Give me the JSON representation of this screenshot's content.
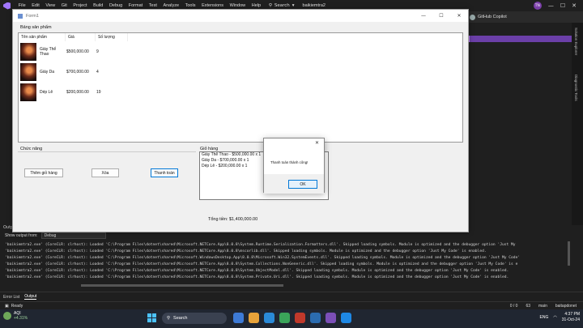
{
  "vs": {
    "menu": [
      "File",
      "Edit",
      "View",
      "Git",
      "Project",
      "Build",
      "Debug",
      "Format",
      "Test",
      "Analyze",
      "Tools",
      "Extensions",
      "Window",
      "Help"
    ],
    "search_label": "Search",
    "project_name": "baikiemtra2",
    "avatar_initials": "TN",
    "copilot_label": "GitHub Copilot",
    "side_tabs": [
      "Solution Explorer",
      "Diagnostic Tools"
    ]
  },
  "form": {
    "title": "Form1",
    "products_group": "Bảng sản phẩm",
    "columns": [
      "Tên sản phẩm",
      "Giá",
      "Số lượng"
    ],
    "rows": [
      {
        "name": "Giày Thể Thao",
        "price": "$500,000.00",
        "qty": "9"
      },
      {
        "name": "Giày Da",
        "price": "$700,000.00",
        "qty": "4"
      },
      {
        "name": "Dép Lê",
        "price": "$200,000.00",
        "qty": "19"
      }
    ],
    "functions_group": "Chức năng",
    "btn_add": "Thêm giỏ hàng",
    "btn_delete": "Xóa",
    "btn_checkout": "Thanh toán",
    "cart_group": "Giỏ hàng",
    "cart_items": [
      "Giày Thể Thao - $500,000.00 x 1",
      "Giày Da - $700,000.00 x 1",
      "Dép Lê - $200,000.00 x 1"
    ],
    "total": "Tổng tiền: $1,400,000.00"
  },
  "dialog": {
    "message": "Thanh toán thành công!",
    "ok": "OK"
  },
  "output": {
    "title": "Output",
    "show_from_label": "Show output from:",
    "source": "Debug",
    "lines": [
      "'baikiemtra2.exe' (CoreCLR: clrhost): Loaded 'C:\\Program Files\\dotnet\\shared\\Microsoft.NETCore.App\\8.0.8\\System.Runtime.Serialization.Formatters.dll'. Skipped loading symbols. Module is optimized and the debugger option 'Just My",
      "'baikiemtra2.exe' (CoreCLR: clrhost): Loaded 'C:\\Program Files\\dotnet\\shared\\Microsoft.NETCore.App\\8.0.8\\mscorlib.dll'. Skipped loading symbols. Module is optimized and the debugger option 'Just My Code' is enabled.",
      "'baikiemtra2.exe' (CoreCLR: clrhost): Loaded 'C:\\Program Files\\dotnet\\shared\\Microsoft.WindowsDesktop.App\\8.0.8\\Microsoft.Win32.SystemEvents.dll'. Skipped loading symbols. Module is optimized and the debugger option 'Just My Code'",
      "'baikiemtra2.exe' (CoreCLR: clrhost): Loaded 'C:\\Program Files\\dotnet\\shared\\Microsoft.NETCore.App\\8.0.8\\System.Collections.NonGeneric.dll'. Skipped loading symbols. Module is optimized and the debugger option 'Just My Code' is e",
      "'baikiemtra2.exe' (CoreCLR: clrhost): Loaded 'C:\\Program Files\\dotnet\\shared\\Microsoft.NETCore.App\\8.0.8\\System.ObjectModel.dll'. Skipped loading symbols. Module is optimized and the debugger option 'Just My Code' is enabled.",
      "'baikiemtra2.exe' (CoreCLR: clrhost): Loaded 'C:\\Program Files\\dotnet\\shared\\Microsoft.NETCore.App\\8.0.8\\System.Private.Uri.dll'. Skipped loading symbols. Module is optimized and the debugger option 'Just My Code' is enabled."
    ]
  },
  "bottom_tabs": [
    "Error List",
    "Output"
  ],
  "status": {
    "ready": "Ready",
    "arrows": "0 / 0",
    "edits": "63",
    "branch": "main",
    "repo": "baitapdonet"
  },
  "taskbar": {
    "temp": "AQI",
    "change": "+4.31%",
    "search": "Search",
    "lang": "ENG",
    "time": "4:37 PM",
    "date": "31-Oct-24"
  }
}
